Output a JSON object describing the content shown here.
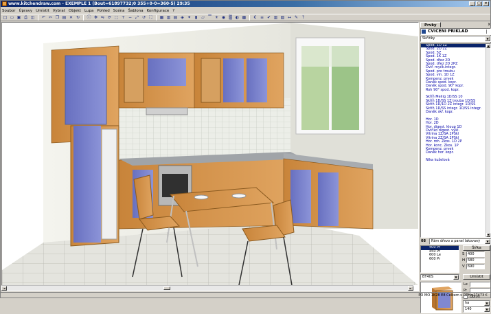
{
  "window": {
    "title": "www.kitchendraw.com - EXEMPLE 1  (Bout=61897732;0 355+0-0=360-5) 29:35"
  },
  "menu": [
    "Soubor",
    "Úpravy",
    "Umístit",
    "Vybrat",
    "Objekt",
    "Lupa",
    "Pohled",
    "Scéna",
    "Šablona",
    "Konfigurace",
    "?"
  ],
  "toolbar": {
    "icons": [
      "new-icon",
      "open-icon",
      "save-icon",
      "print-icon",
      "print-preview-icon",
      "undo-icon",
      "cut-icon",
      "copy-icon",
      "paste-icon",
      "delete-icon",
      "rotate-icon",
      "info-icon",
      "move-icon",
      "mirror-icon",
      "rotate-object-icon",
      "zoom-window-icon",
      "zoom-in-icon",
      "zoom-out-icon",
      "zoom-all-icon",
      "zoom-previous-icon",
      "zoom-extents-icon",
      "plan-view-icon",
      "front-view-icon",
      "elevation-icon",
      "perspective-icon",
      "render-icon",
      "walls-icon",
      "floor-icon",
      "ceiling-icon",
      "lights-icon",
      "camera-icon",
      "materials-icon",
      "colors-icon",
      "texture-icon",
      "price-icon",
      "quote-icon",
      "order-icon",
      "stats-icon",
      "layer-icon",
      "dimension-icon",
      "note-icon",
      "help-icon"
    ]
  },
  "panel": {
    "tabs": [
      "Prvky"
    ],
    "close": "x",
    "header": "CVIČENÍ PŘÍKLAD",
    "category": "Skříňky",
    "items": [
      "Spod. 1D 1Z",
      "Spod. 2D 2Z",
      "Spod. 5Z",
      "Spod. 1K 1Z",
      "Spod. dřez 2D",
      "Spod. dřez 2D 2PZ",
      "Dvíř. myčk.integr.",
      "Spod. pro troubu",
      "Spod. vin. 1D 1Z",
      "Kompenz. prvek",
      "Daněk spod. kopr.",
      "Daněk spod. 90° kopr.",
      "Roh 90° spod. kopr.",
      "",
      "Skříň Meilig 1D/SS 10",
      "Skříň 1D/SS 1Z trouba 1D/SS",
      "Skříň 1D/1D 2Z integr. 1D/SS",
      "Skříň 1D/SS integr. 1D/SS integr.",
      "Daněk skř. kopr.",
      "",
      "Hor. 1D",
      "Hor. 2D",
      "Hor. digest. kloup 1D",
      "Dvíř.ko digest. výkl.",
      "Vitrina 1Z/SA 2PSkl",
      "Vitrina 2Z/SA 2PSkl",
      "Hor. roh. Zkos. 1D 2P",
      "Hor. konc. Zkos. 1P",
      "Kompenz. prvek",
      "Daněk hor. kopr.",
      "",
      "Nika kuželová"
    ],
    "material": {
      "number": "08",
      "value": "Rám dřevo a panel lakovaný"
    },
    "sizes": [
      "400 Pr",
      "450 Pr",
      "600 Le",
      "600 Pr"
    ],
    "dims": {
      "width_button": "Šířka",
      "s_label": "S",
      "s_value": "400",
      "h_label": "H",
      "h_value": "580",
      "v_label": "V",
      "v_value": "690",
      "place_button": "Umístit"
    },
    "code": "BT40S",
    "props": {
      "le_label": "Le",
      "pr_label": "Pr",
      "obrys_label": "Obrys",
      "ha_value": "ha",
      "num_value": "140"
    }
  },
  "status": {
    "text": "PO MO 1K28 E8 Celkem s DPH=27473 €"
  }
}
